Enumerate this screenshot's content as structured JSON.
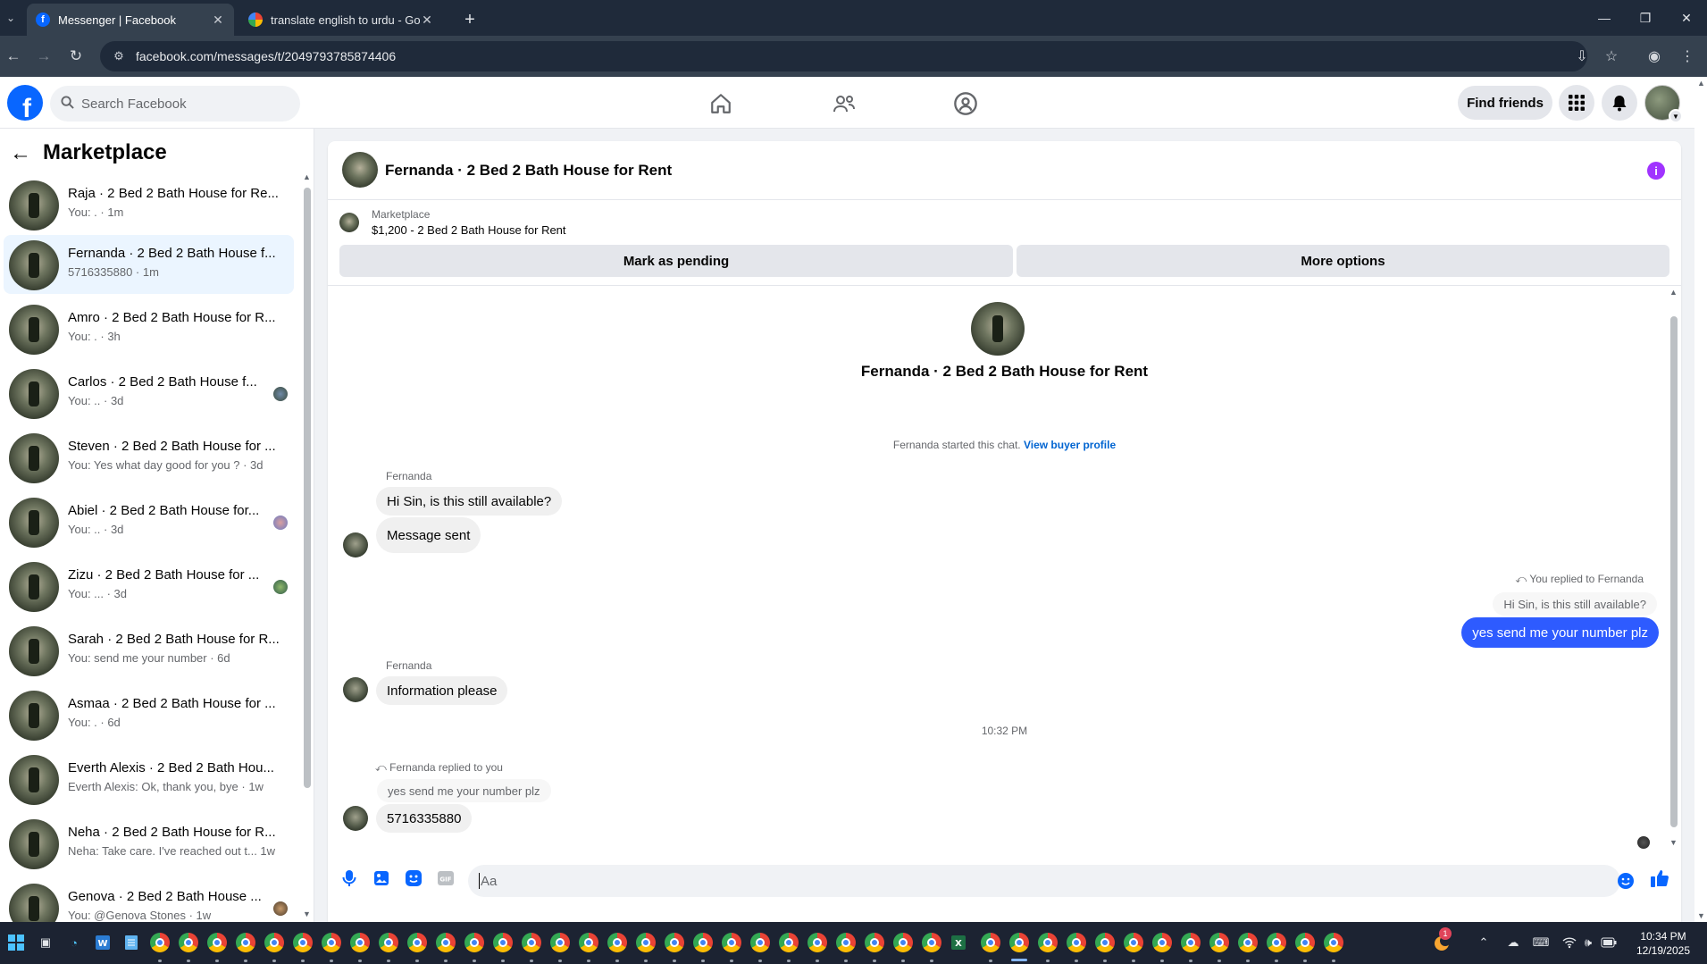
{
  "browser": {
    "tabs": [
      {
        "title": "Messenger | Facebook",
        "active": true
      },
      {
        "title": "translate english to urdu - Goog",
        "active": false
      }
    ],
    "url": "facebook.com/messages/t/2049793785874406"
  },
  "header": {
    "search_placeholder": "Search Facebook",
    "find_friends": "Find friends"
  },
  "sidebar": {
    "title": "Marketplace",
    "conversations": [
      {
        "name": "Raja · 2 Bed 2 Bath House for Re...",
        "sub": "You: . · 1m",
        "selected": false,
        "seen": false
      },
      {
        "name": "Fernanda · 2 Bed 2 Bath House f...",
        "sub": "5716335880 · 1m",
        "selected": true,
        "seen": false
      },
      {
        "name": "Amro · 2 Bed 2 Bath House for R...",
        "sub": "You: . · 3h",
        "selected": false,
        "seen": false
      },
      {
        "name": "Carlos · 2 Bed 2 Bath House f...",
        "sub": "You: .. · 3d",
        "selected": false,
        "seen": true
      },
      {
        "name": "Steven · 2 Bed 2 Bath House for ...",
        "sub": "You: Yes what day good for you ? · 3d",
        "selected": false,
        "seen": false
      },
      {
        "name": "Abiel · 2 Bed 2 Bath House for...",
        "sub": "You: .. · 3d",
        "selected": false,
        "seen": true
      },
      {
        "name": "Zizu · 2 Bed 2 Bath House for ...",
        "sub": "You: ... · 3d",
        "selected": false,
        "seen": true
      },
      {
        "name": "Sarah · 2 Bed 2 Bath House for R...",
        "sub": "You: send me your number · 6d",
        "selected": false,
        "seen": false
      },
      {
        "name": "Asmaa · 2 Bed 2 Bath House for ...",
        "sub": "You: . · 6d",
        "selected": false,
        "seen": false
      },
      {
        "name": "Everth Alexis · 2 Bed 2 Bath Hou...",
        "sub": "Everth Alexis: Ok, thank you, bye · 1w",
        "selected": false,
        "seen": false
      },
      {
        "name": "Neha · 2 Bed 2 Bath House for R...",
        "sub": "Neha: Take care. I've reached out t... 1w",
        "selected": false,
        "seen": false
      },
      {
        "name": "Genova · 2 Bed 2 Bath House ...",
        "sub": "You: @Genova Stones · 1w",
        "selected": false,
        "seen": true
      }
    ]
  },
  "chat": {
    "title": "Fernanda · 2 Bed 2 Bath House for Rent",
    "listing_source": "Marketplace",
    "listing_line": "$1,200 - 2 Bed 2 Bath House for Rent",
    "mark_pending": "Mark as pending",
    "more_options": "More options",
    "profile_name": "Fernanda · 2 Bed 2 Bath House for Rent",
    "started_text": "Fernanda started this chat.",
    "view_buyer": "View buyer profile",
    "sender_name": "Fernanda",
    "msg1": "Hi Sin, is this still available?",
    "msg2": "Message sent",
    "you_replied": "You replied to Fernanda",
    "quoted_msg": "Hi Sin, is this still available?",
    "my_msg": "yes send me your number plz",
    "msg3": "Information please",
    "timestamp": "10:32 PM",
    "fernanda_replied": "Fernanda replied to you",
    "quoted_reply": "yes send me your number plz",
    "msg4": "5716335880",
    "composer_placeholder": "Aa"
  },
  "taskbar": {
    "time": "10:34 PM",
    "date": "12/19/2025",
    "notification_count": "1"
  },
  "colors": {
    "fb_blue": "#0866ff",
    "my_bubble": "#2e5bff",
    "selected_conv": "#ebf5ff",
    "info_purple": "#a033ff"
  }
}
